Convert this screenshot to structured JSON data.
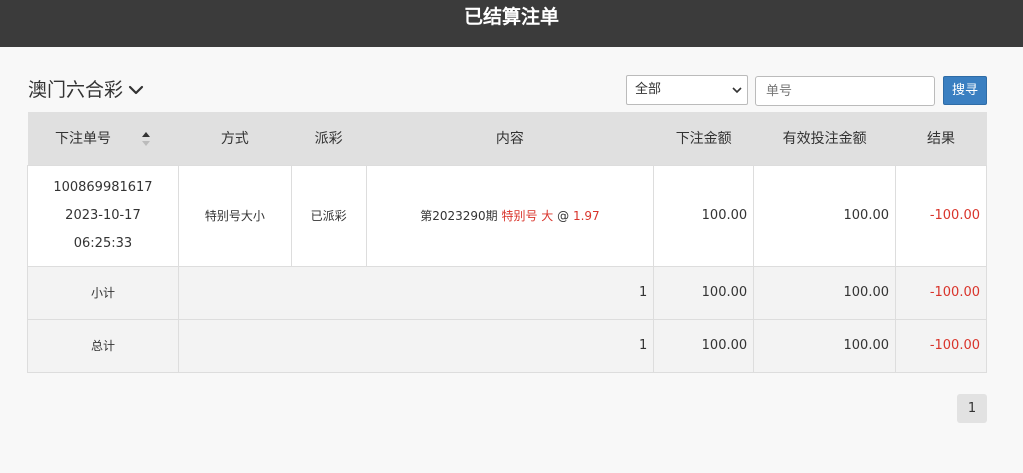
{
  "header": {
    "title": "已结算注单"
  },
  "lottery": {
    "name": "澳门六合彩",
    "icon": "chevron-down-icon"
  },
  "filter": {
    "selected": "全部"
  },
  "search": {
    "placeholder": "单号",
    "button_label": "搜寻"
  },
  "table": {
    "columns": [
      "下注单号",
      "方式",
      "派彩",
      "内容",
      "下注金额",
      "有效投注金额",
      "结果"
    ],
    "rows": [
      {
        "order_no": "100869981617",
        "date": "2023-10-17",
        "time": "06:25:33",
        "method": "特别号大小",
        "payout": "已派彩",
        "content_prefix": "第2023290期",
        "content_bet": "特别号 大",
        "content_at": "@",
        "content_odds": "1.97",
        "amount": "100.00",
        "valid_amount": "100.00",
        "result": "-100.00"
      }
    ],
    "subtotal": {
      "label": "小计",
      "count": "1",
      "amount": "100.00",
      "valid_amount": "100.00",
      "result": "-100.00"
    },
    "total": {
      "label": "总计",
      "count": "1",
      "amount": "100.00",
      "valid_amount": "100.00",
      "result": "-100.00"
    }
  },
  "pagination": {
    "current": "1"
  },
  "colors": {
    "topbar": "#3b3b3b",
    "accent": "#3a7fc1",
    "negative": "#d9342b"
  }
}
